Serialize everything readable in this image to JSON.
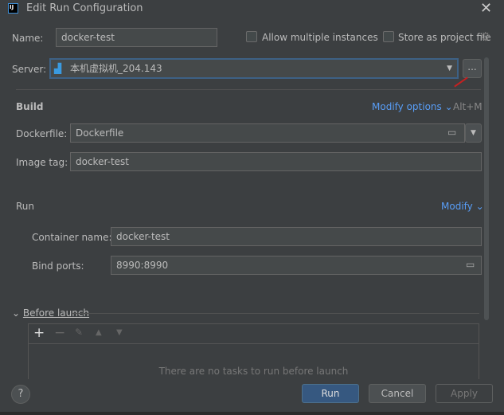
{
  "window": {
    "title": "Edit Run Configuration"
  },
  "name": {
    "label": "Name:",
    "value": "docker-test"
  },
  "allow_multiple": {
    "label": "Allow multiple instances",
    "checked": false
  },
  "store_project": {
    "label": "Store as project file",
    "checked": false
  },
  "server": {
    "label": "Server:",
    "value": "本机虚拟机_204.143",
    "more": "..."
  },
  "build": {
    "title": "Build",
    "modify": "Modify options",
    "shortcut": "Alt+M",
    "dockerfile_label": "Dockerfile:",
    "dockerfile_value": "Dockerfile",
    "image_tag_label": "Image tag:",
    "image_tag_value": "docker-test"
  },
  "run": {
    "title": "Run",
    "modify": "Modify",
    "container_label": "Container name:",
    "container_value": "docker-test",
    "ports_label": "Bind ports:",
    "ports_value": "8990:8990"
  },
  "before_launch": {
    "title": "Before launch",
    "empty": "There are no tasks to run before launch"
  },
  "footer": {
    "help": "?",
    "run": "Run",
    "cancel": "Cancel",
    "apply": "Apply"
  }
}
